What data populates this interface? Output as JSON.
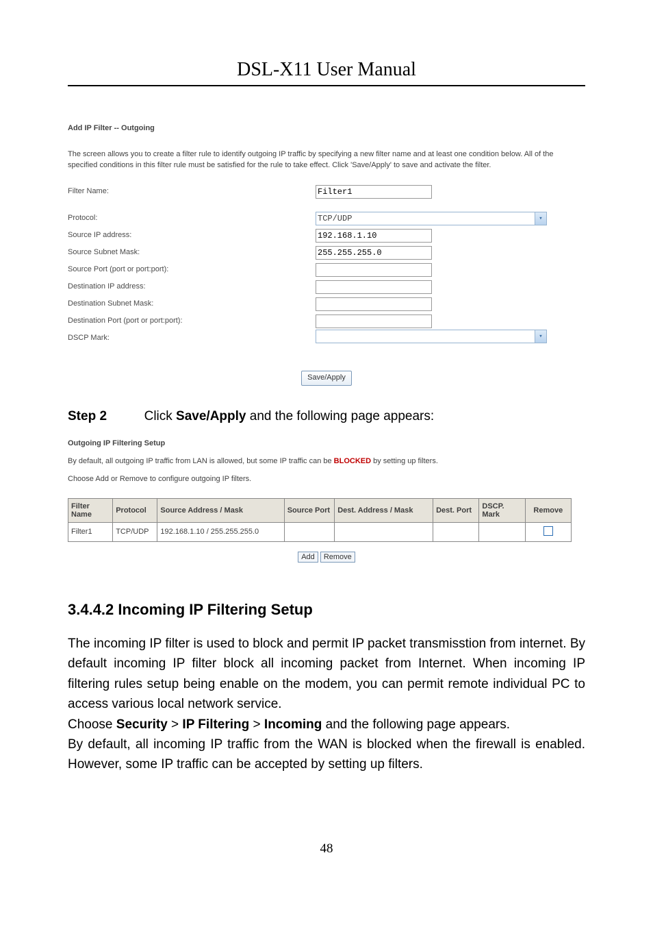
{
  "header": {
    "title": "DSL-X11 User Manual"
  },
  "shot1": {
    "heading": "Add IP Filter -- Outgoing",
    "intro": "The screen allows you to create a filter rule to identify outgoing IP traffic by specifying a new filter name and at least one condition below. All of the specified conditions in this filter rule must be satisfied for the rule to take effect. Click 'Save/Apply' to save and activate the filter.",
    "rows": {
      "filter_name": {
        "label": "Filter Name:",
        "value": "Filter1"
      },
      "protocol": {
        "label": "Protocol:",
        "value": "TCP/UDP"
      },
      "src_ip": {
        "label": "Source IP address:",
        "value": "192.168.1.10"
      },
      "src_mask": {
        "label": "Source Subnet Mask:",
        "value": "255.255.255.0"
      },
      "src_port": {
        "label": "Source Port (port or port:port):",
        "value": ""
      },
      "dst_ip": {
        "label": "Destination IP address:",
        "value": ""
      },
      "dst_mask": {
        "label": "Destination Subnet Mask:",
        "value": ""
      },
      "dst_port": {
        "label": "Destination Port (port or port:port):",
        "value": ""
      },
      "dscp": {
        "label": "DSCP Mark:",
        "value": ""
      }
    },
    "save_apply": "Save/Apply"
  },
  "step2": {
    "prefix": "Step 2",
    "mid1": "Click ",
    "bold": "Save/Apply",
    "mid2": " and the following page appears:"
  },
  "shot2": {
    "heading": "Outgoing IP Filtering Setup",
    "line1a": "By default, all outgoing IP traffic from LAN is allowed, but some IP traffic can be ",
    "line1b": "BLOCKED",
    "line1c": " by setting up filters.",
    "line2": "Choose Add or Remove to configure outgoing IP filters.",
    "table": {
      "headers": {
        "c1": "Filter Name",
        "c2": "Protocol",
        "c3": "Source Address / Mask",
        "c4": "Source Port",
        "c5": "Dest. Address / Mask",
        "c6": "Dest. Port",
        "c7": "DSCP. Mark",
        "c8": "Remove"
      },
      "row": {
        "c1": "Filter1",
        "c2": "TCP/UDP",
        "c3": "192.168.1.10 / 255.255.255.0",
        "c4": "",
        "c5": "",
        "c6": "",
        "c7": ""
      }
    },
    "btn_add": "Add",
    "btn_remove": "Remove"
  },
  "section": {
    "heading": "3.4.4.2  Incoming IP Filtering Setup",
    "para1": "The incoming IP filter is used to block and permit IP packet transmisstion from internet. By default incoming IP filter block all incoming packet from Internet. When incoming IP filtering rules setup being enable on the modem, you can permit remote individual PC to access various local network service.",
    "nav_a": "Choose ",
    "nav_b": "Security",
    "nav_c": " > ",
    "nav_d": "IP Filtering",
    "nav_e": " > ",
    "nav_f": "Incoming",
    "nav_g": " and the following page appears.",
    "para2": "By default, all incoming IP traffic from the WAN is blocked when the firewall is enabled. However, some IP traffic can be accepted by setting up filters."
  },
  "page_number": "48"
}
